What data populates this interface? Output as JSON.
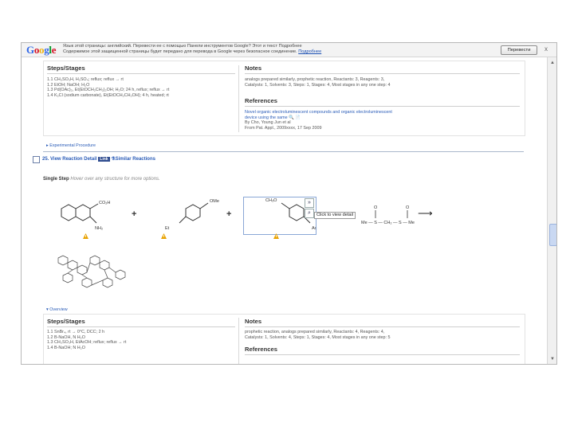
{
  "google_bar": {
    "logo_letters": [
      {
        "ch": "G",
        "color": "#3369e8"
      },
      {
        "ch": "o",
        "color": "#d50f25"
      },
      {
        "ch": "o",
        "color": "#eeb211"
      },
      {
        "ch": "g",
        "color": "#3369e8"
      },
      {
        "ch": "l",
        "color": "#009925"
      },
      {
        "ch": "e",
        "color": "#d50f25"
      }
    ],
    "line1": "Язык этой страницы: английский. Перевести ее с помощью Панели инструментов Google? Этот и текст Подробнее",
    "line2": "Содержимое этой защищенной страницы будет передано для перевода в Google через безопасное соединение.",
    "line2_link": "Подробнее",
    "translate_button": "Перевести",
    "close": "x"
  },
  "block1": {
    "steps_header": "Steps/Stages",
    "steps": [
      "1.1  CH₃SO₃H, H₂SO₄; reflux; reflux → rt",
      "1.2  EtOH; NaOH; H₂O",
      "1.3  Pd(OAc)₂, Et(EtOCH₂CH₂)₂OH; H₂O; 24 h, reflux; reflux → rt",
      "1.4  K₂Cl (sodium carbonate), Et(EtOCH₂CH₂OH); 4 h, heated; rt"
    ],
    "notes_header": "Notes",
    "notes": [
      "analogs prepared similarly, prophetic reaction, Reactants: 3, Reagents: 3,",
      "Catalysts: 1, Solvents: 3, Steps: 1, Stages: 4, Most stages in any one step: 4"
    ],
    "references_header": "References",
    "ref_title_1": "Novel organic electroluminescent compounds and organic electroluminescent",
    "ref_title_2": "device using the same",
    "ref_by": "By Cho, Young Jun et al",
    "ref_source": "From Pat. Appl., 2009xxxx, 17 Sep 2009"
  },
  "experimental": "Experimental Procedure",
  "reaction2": {
    "number": "25.",
    "view_link": "View Reaction Detail",
    "link_badge": "Link",
    "similar": "Similar Reactions",
    "single_step": "Single Step",
    "hint": "Hover over any structure for more options.",
    "mol1_sub1": "CO₂H",
    "mol1_sub2": "NH₂",
    "mol2_sub1": "OMe",
    "mol2_sub2": "Et",
    "mol3_sub1": "CH₃O",
    "mol3_sub2": "Ac",
    "tooltip": "Click to view detail",
    "mol4_label": "Me — S — CH₂ — S — Me",
    "mol4_o1": "O",
    "mol4_o2": "O",
    "overview": "Overview"
  },
  "block2": {
    "steps_header": "Steps/Stages",
    "steps": [
      "1.1  SnBr₄, rt → 0°C, DCC; 2 h",
      "1.2  B-NaOH, N H₂O",
      "1.3  CH₃SO₃H, EtAcOH; reflux; reflux → rt",
      "1.4  B-NaOH; N H₂O"
    ],
    "notes_header": "Notes",
    "notes": [
      "prophetic reaction, analogs prepared similarly, Reactants: 4, Reagents: 4,",
      "Catalysts: 1, Solvents: 4, Steps: 1, Stages: 4, Most stages in any one step: 5"
    ],
    "references_header": "References"
  },
  "colors": {
    "link": "#2a5cb8",
    "warning": "#e8a200"
  }
}
